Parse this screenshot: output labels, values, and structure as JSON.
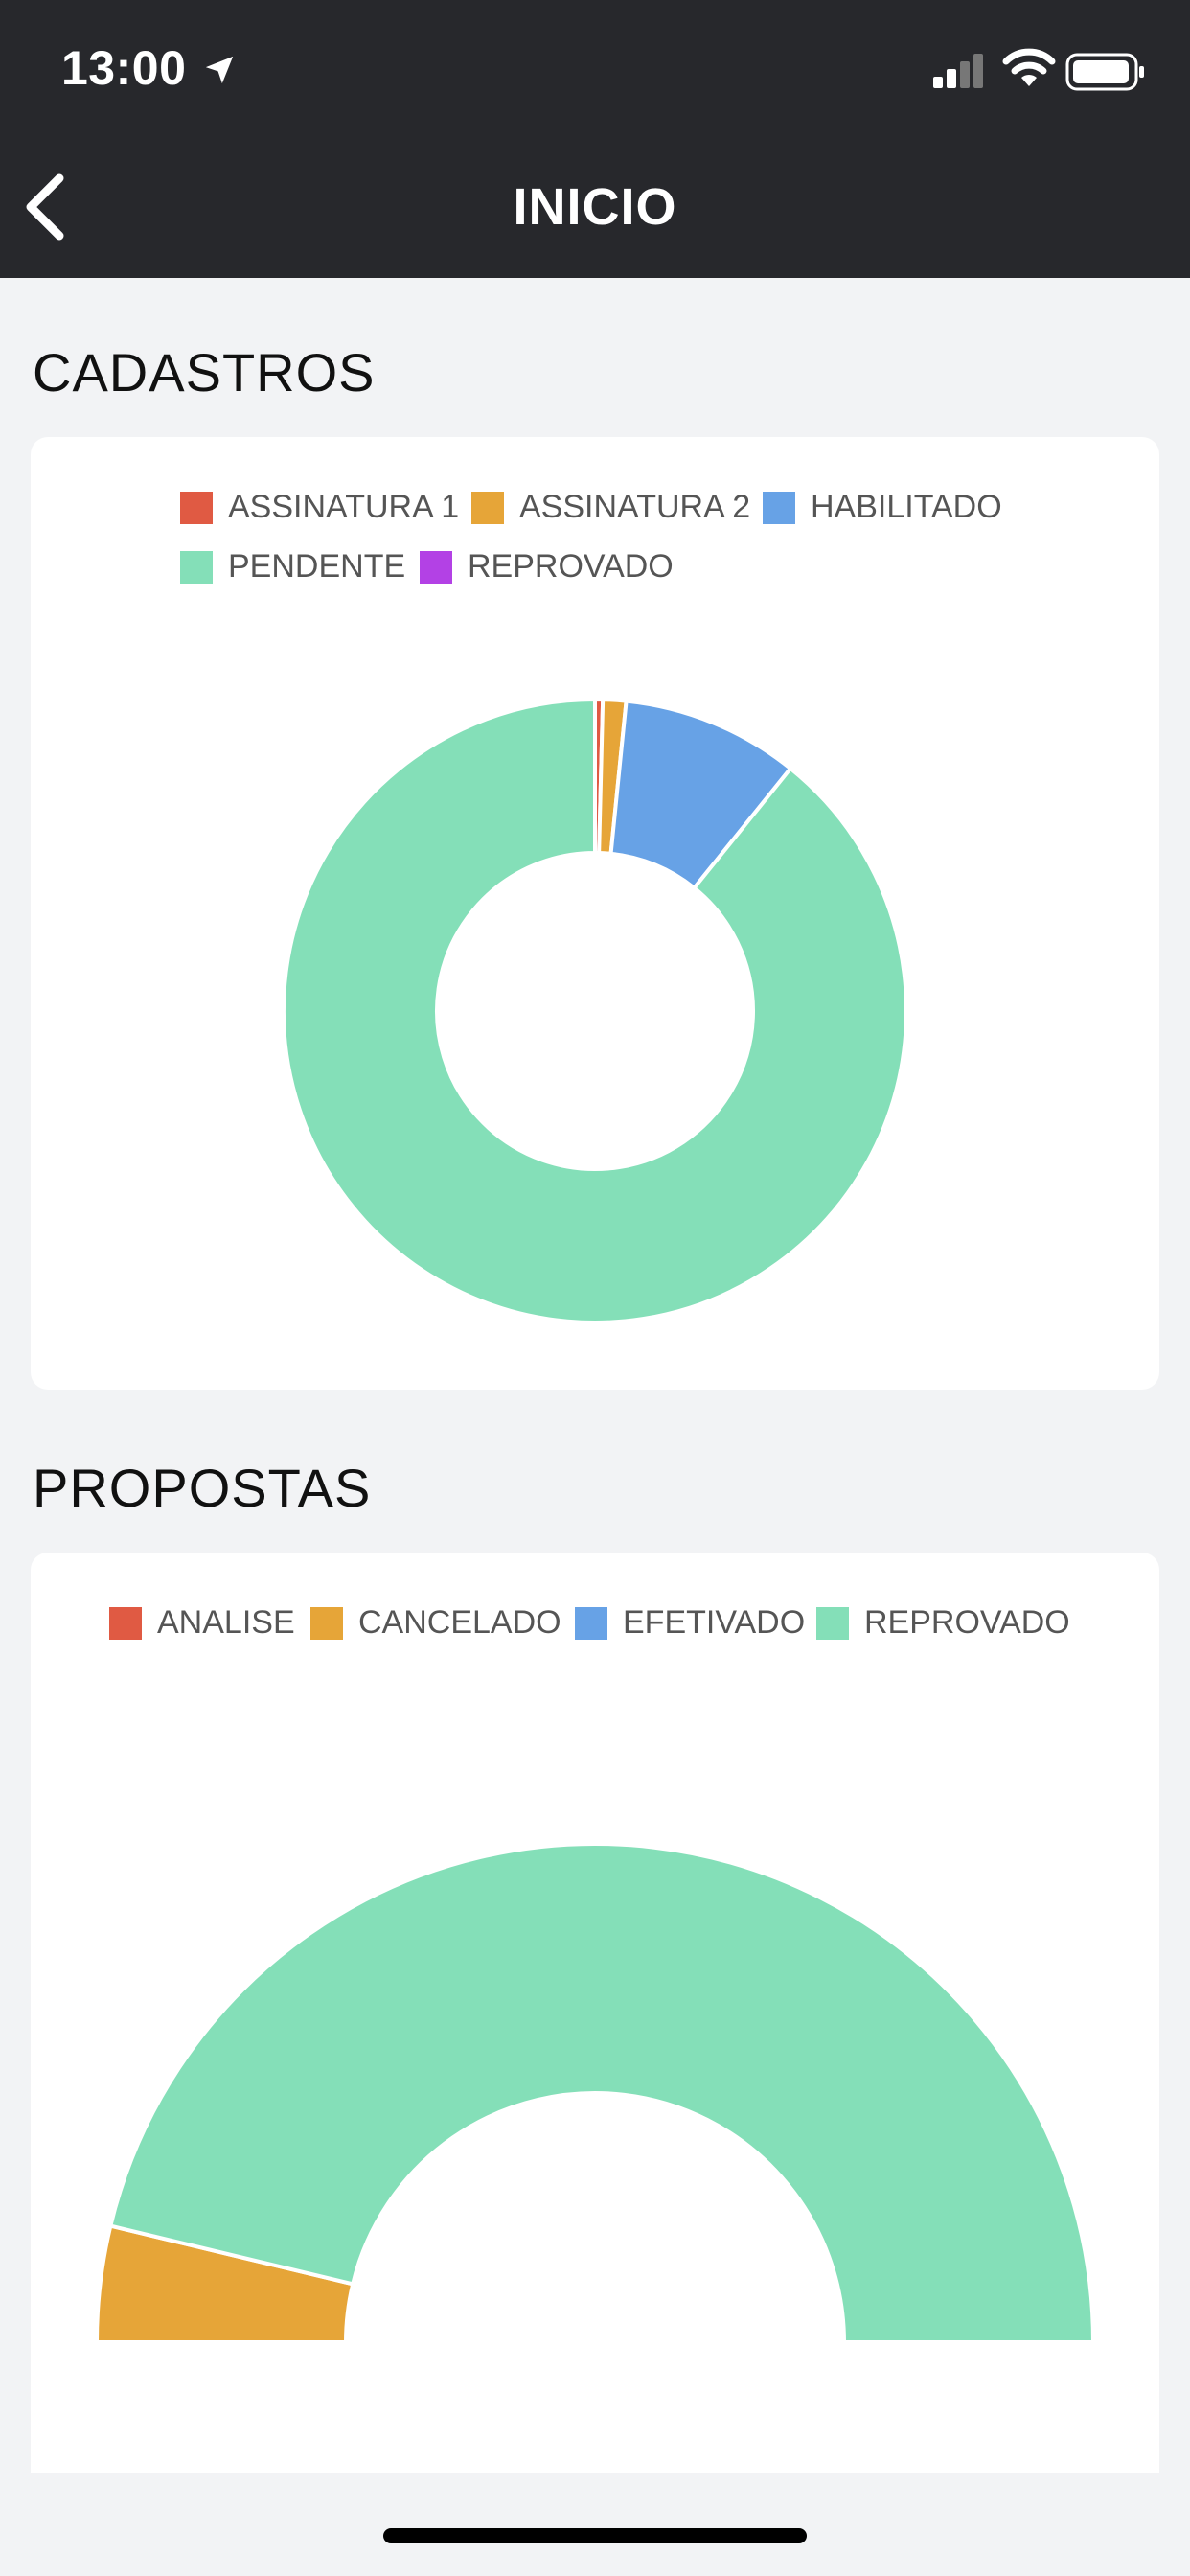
{
  "status": {
    "time": "13:00"
  },
  "header": {
    "title": "INICIO"
  },
  "sections": {
    "cadastros_title": "CADASTROS",
    "propostas_title": "PROPOSTAS"
  },
  "chart_data": [
    {
      "type": "pie",
      "variant": "doughnut",
      "legend_position": "top",
      "categories": [
        "ASSINATURA 1",
        "ASSINATURA 2",
        "HABILITADO",
        "PENDENTE",
        "REPROVADO"
      ],
      "colors": [
        "#e05a43",
        "#e6a538",
        "#67a2e6",
        "#84dfb8",
        "#b341e5"
      ],
      "values": [
        0.4,
        1.2,
        9.2,
        89.2,
        0
      ]
    },
    {
      "type": "pie",
      "variant": "half-doughnut",
      "legend_position": "top",
      "categories": [
        "ANALISE",
        "CANCELADO",
        "EFETIVADO",
        "REPROVADO"
      ],
      "colors": [
        "#e05a43",
        "#e6a538",
        "#67a2e6",
        "#84dfb8"
      ],
      "values": [
        0,
        7.5,
        0,
        92.5
      ]
    }
  ]
}
